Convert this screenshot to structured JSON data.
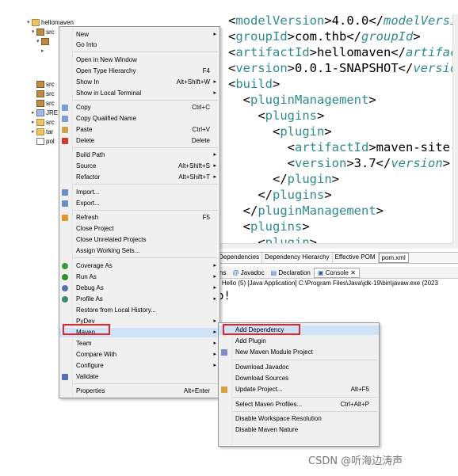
{
  "explorer": {
    "project": "hellomaven",
    "rows": [
      {
        "label": "src",
        "icon": "folder-icon"
      },
      {
        "label": "src",
        "icon": "folder-icon"
      },
      {
        "label": "src",
        "icon": "folder-icon"
      },
      {
        "label": "src",
        "icon": "folder-icon"
      },
      {
        "label": "JRE",
        "icon": "library-icon"
      },
      {
        "label": "src",
        "icon": "folder-icon"
      },
      {
        "label": "tar",
        "icon": "folder-icon"
      },
      {
        "label": "pol",
        "icon": "file-icon"
      }
    ]
  },
  "editor": {
    "lines": [
      {
        "open": "modelVersion",
        "text": "4.0.0",
        "close": "modelVersi"
      },
      {
        "open": "groupId",
        "text": "com.thb",
        "close": "groupId"
      },
      {
        "open": "artifactId",
        "text": "hellomaven",
        "close": "artifac"
      },
      {
        "open": "version",
        "text": "0.0.1-SNAPSHOT",
        "close": "versio"
      },
      {
        "open": "build"
      },
      {
        "open": "pluginManagement"
      },
      {
        "open": "plugins"
      },
      {
        "open": "plugin"
      },
      {
        "open": "artifactId",
        "text": "maven-site-"
      },
      {
        "open": "version",
        "text": "3.7",
        "close": "version"
      },
      {
        "close": "plugin"
      },
      {
        "close": "plugins"
      },
      {
        "close": "pluginManagement"
      },
      {
        "open": "plugins"
      },
      {
        "open": "plugin"
      }
    ]
  },
  "pom_tabs": [
    "Dependencies",
    "Dependency Hierarchy",
    "Effective POM",
    "pom.xml"
  ],
  "console": {
    "tabs": [
      "ns",
      "Javadoc",
      "Declaration",
      "Console"
    ],
    "info": "> Hello (5) [Java Application] C:\\Program Files\\Java\\jdk-19\\bin\\javaw.exe  (2023",
    "output": "o!"
  },
  "context_menu": {
    "items": [
      {
        "label": "New",
        "shortcut": "",
        "submenu": true
      },
      {
        "label": "Go Into",
        "shortcut": ""
      },
      {
        "label": "Open in New Window",
        "shortcut": ""
      },
      {
        "label": "Open Type Hierarchy",
        "shortcut": "F4"
      },
      {
        "label": "Show In",
        "shortcut": "Alt+Shift+W",
        "submenu": true
      },
      {
        "label": "Show in Local Terminal",
        "shortcut": "",
        "submenu": true
      },
      {
        "label": "Copy",
        "shortcut": "Ctrl+C"
      },
      {
        "label": "Copy Qualified Name",
        "shortcut": ""
      },
      {
        "label": "Paste",
        "shortcut": "Ctrl+V"
      },
      {
        "label": "Delete",
        "shortcut": "Delete"
      },
      {
        "label": "Build Path",
        "shortcut": "",
        "submenu": true
      },
      {
        "label": "Source",
        "shortcut": "Alt+Shift+S",
        "submenu": true
      },
      {
        "label": "Refactor",
        "shortcut": "Alt+Shift+T",
        "submenu": true
      },
      {
        "label": "Import...",
        "shortcut": ""
      },
      {
        "label": "Export...",
        "shortcut": ""
      },
      {
        "label": "Refresh",
        "shortcut": "F5"
      },
      {
        "label": "Close Project",
        "shortcut": ""
      },
      {
        "label": "Close Unrelated Projects",
        "shortcut": ""
      },
      {
        "label": "Assign Working Sets...",
        "shortcut": ""
      },
      {
        "label": "Coverage As",
        "shortcut": "",
        "submenu": true
      },
      {
        "label": "Run As",
        "shortcut": "",
        "submenu": true
      },
      {
        "label": "Debug As",
        "shortcut": "",
        "submenu": true
      },
      {
        "label": "Profile As",
        "shortcut": "",
        "submenu": true
      },
      {
        "label": "Restore from Local History...",
        "shortcut": ""
      },
      {
        "label": "PyDev",
        "shortcut": "",
        "submenu": true
      },
      {
        "label": "Maven",
        "shortcut": "",
        "submenu": true
      },
      {
        "label": "Team",
        "shortcut": "",
        "submenu": true
      },
      {
        "label": "Compare With",
        "shortcut": "",
        "submenu": true
      },
      {
        "label": "Configure",
        "shortcut": "",
        "submenu": true
      },
      {
        "label": "Validate",
        "shortcut": ""
      },
      {
        "label": "Properties",
        "shortcut": "Alt+Enter"
      }
    ]
  },
  "maven_submenu": {
    "items": [
      {
        "label": "Add Dependency",
        "shortcut": ""
      },
      {
        "label": "Add Plugin",
        "shortcut": ""
      },
      {
        "label": "New Maven Module Project",
        "shortcut": ""
      },
      {
        "label": "Download Javadoc",
        "shortcut": ""
      },
      {
        "label": "Download Sources",
        "shortcut": ""
      },
      {
        "label": "Update Project...",
        "shortcut": "Alt+F5"
      },
      {
        "label": "Select Maven Profiles...",
        "shortcut": "Ctrl+Alt+P"
      },
      {
        "label": "Disable Workspace Resolution",
        "shortcut": ""
      },
      {
        "label": "Disable Maven Nature",
        "shortcut": ""
      }
    ]
  },
  "watermark": "CSDN @听海边涛声",
  "colors": {
    "highlight_box": "#e8232a",
    "xml_tag": "#2e8b8b"
  }
}
